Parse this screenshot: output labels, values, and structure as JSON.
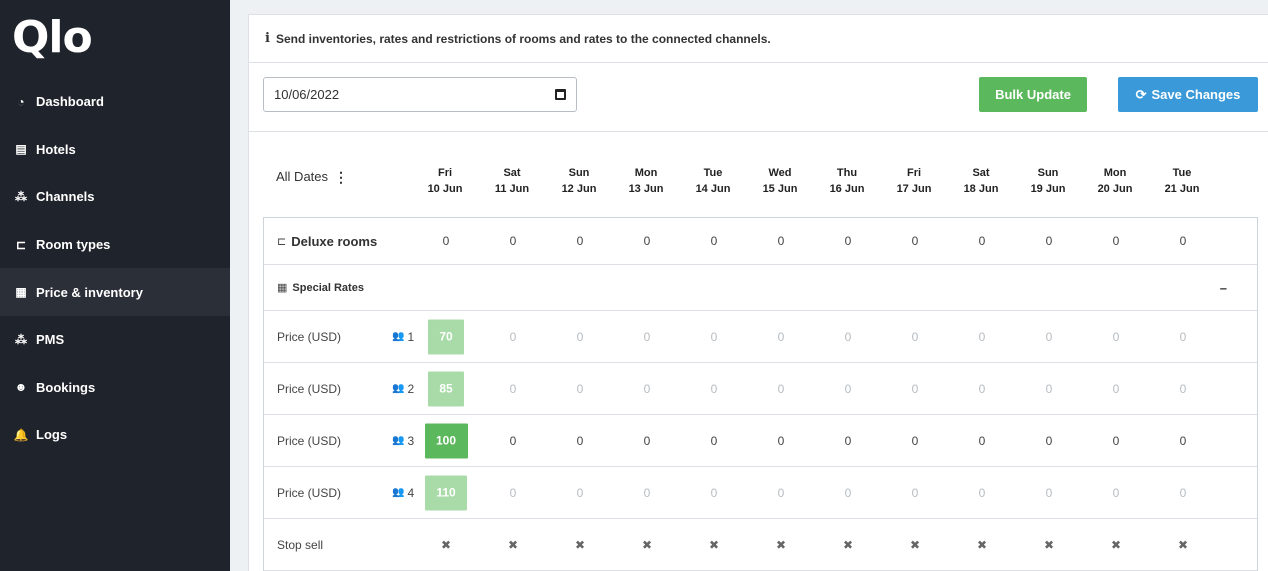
{
  "logo_text": "Qlo",
  "sidebar": {
    "items": [
      {
        "label": "Dashboard",
        "icon": "dashboard-icon",
        "glyph": "◔"
      },
      {
        "label": "Hotels",
        "icon": "hotel-icon",
        "glyph": "▤"
      },
      {
        "label": "Channels",
        "icon": "channels-icon",
        "glyph": "⁂"
      },
      {
        "label": "Room types",
        "icon": "bed-icon",
        "glyph": "⊏"
      },
      {
        "label": "Price & inventory",
        "icon": "clipboard-icon",
        "glyph": "▦"
      },
      {
        "label": "PMS",
        "icon": "pms-icon",
        "glyph": "⁂"
      },
      {
        "label": "Bookings",
        "icon": "users-icon",
        "glyph": "☻"
      },
      {
        "label": "Logs",
        "icon": "bell-icon",
        "glyph": "🔔"
      }
    ],
    "active_index": 4
  },
  "info": {
    "text": "Send inventories, rates and restrictions of rooms and rates to the connected channels."
  },
  "toolbar": {
    "date_value": "10/06/2022",
    "bulk_label": "Bulk Update",
    "save_label": "Save Changes"
  },
  "colors": {
    "sidebar_bg": "#1f232b",
    "bulk": "#5cb85c",
    "save": "#3a9ad9",
    "price_light": "#a8dba8",
    "price_strong": "#5cb85c"
  },
  "all_dates_label": "All Dates",
  "dates": [
    {
      "day": "Fri",
      "date": "10 Jun"
    },
    {
      "day": "Sat",
      "date": "11 Jun"
    },
    {
      "day": "Sun",
      "date": "12 Jun"
    },
    {
      "day": "Mon",
      "date": "13 Jun"
    },
    {
      "day": "Tue",
      "date": "14 Jun"
    },
    {
      "day": "Wed",
      "date": "15 Jun"
    },
    {
      "day": "Thu",
      "date": "16 Jun"
    },
    {
      "day": "Fri",
      "date": "17 Jun"
    },
    {
      "day": "Sat",
      "date": "18 Jun"
    },
    {
      "day": "Sun",
      "date": "19 Jun"
    },
    {
      "day": "Mon",
      "date": "20 Jun"
    },
    {
      "day": "Tue",
      "date": "21 Jun"
    }
  ],
  "room": {
    "name": "Deluxe rooms",
    "inventory": [
      "0",
      "0",
      "0",
      "0",
      "0",
      "0",
      "0",
      "0",
      "0",
      "0",
      "0",
      "0"
    ]
  },
  "rate_plan": {
    "name": "Special Rates",
    "collapse_symbol": "–"
  },
  "price_rows": [
    {
      "label": "Price (USD)",
      "occupancy": "1",
      "first": "70",
      "first_style": "light",
      "values": [
        "0",
        "0",
        "0",
        "0",
        "0",
        "0",
        "0",
        "0",
        "0",
        "0",
        "0"
      ],
      "muted": true
    },
    {
      "label": "Price (USD)",
      "occupancy": "2",
      "first": "85",
      "first_style": "light",
      "values": [
        "0",
        "0",
        "0",
        "0",
        "0",
        "0",
        "0",
        "0",
        "0",
        "0",
        "0"
      ],
      "muted": true
    },
    {
      "label": "Price (USD)",
      "occupancy": "3",
      "first": "100",
      "first_style": "strong",
      "values": [
        "0",
        "0",
        "0",
        "0",
        "0",
        "0",
        "0",
        "0",
        "0",
        "0",
        "0"
      ],
      "muted": false
    },
    {
      "label": "Price (USD)",
      "occupancy": "4",
      "first": "110",
      "first_style": "light",
      "values": [
        "0",
        "0",
        "0",
        "0",
        "0",
        "0",
        "0",
        "0",
        "0",
        "0",
        "0"
      ],
      "muted": true
    }
  ],
  "stop_sell": {
    "label": "Stop sell",
    "symbol": "✖"
  }
}
